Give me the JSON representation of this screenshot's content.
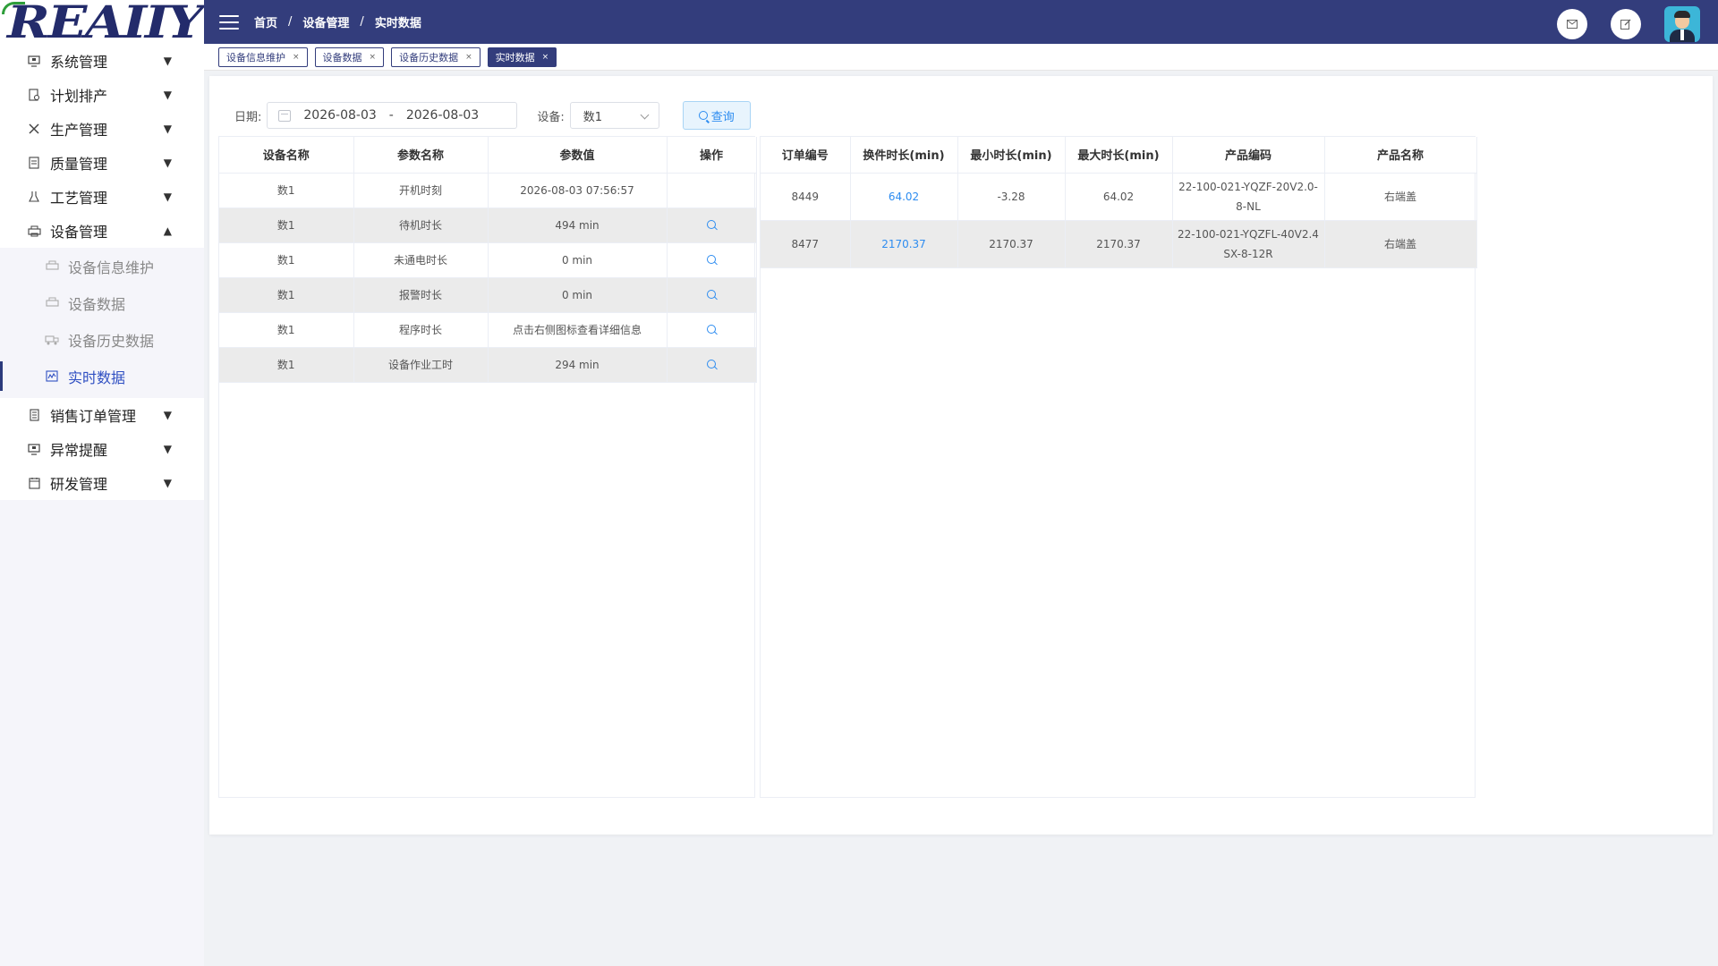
{
  "logo": {
    "text": "REAIIY"
  },
  "header": {
    "breadcrumb": [
      "首页",
      "设备管理",
      "实时数据"
    ],
    "separator": "/"
  },
  "sidebar": {
    "items": [
      {
        "label": "系统管理",
        "icon": "monitor-icon"
      },
      {
        "label": "计划排产",
        "icon": "document-gear-icon"
      },
      {
        "label": "生产管理",
        "icon": "tools-icon"
      },
      {
        "label": "质量管理",
        "icon": "clipboard-icon"
      },
      {
        "label": "工艺管理",
        "icon": "flask-icon"
      },
      {
        "label": "设备管理",
        "icon": "printer-icon",
        "expanded": true
      }
    ],
    "sub_items": [
      {
        "label": "设备信息维护",
        "icon": "printer-icon"
      },
      {
        "label": "设备数据",
        "icon": "printer-icon"
      },
      {
        "label": "设备历史数据",
        "icon": "truck-icon"
      },
      {
        "label": "实时数据",
        "icon": "chart-line-icon",
        "active": true
      }
    ],
    "bottom_items": [
      {
        "label": "销售订单管理",
        "icon": "receipt-icon"
      },
      {
        "label": "异常提醒",
        "icon": "monitor-alert-icon"
      },
      {
        "label": "研发管理",
        "icon": "calendar-icon"
      }
    ]
  },
  "tabs": [
    {
      "label": "设备信息维护",
      "close": "×"
    },
    {
      "label": "设备数据",
      "close": "×"
    },
    {
      "label": "设备历史数据",
      "close": "×"
    },
    {
      "label": "实时数据",
      "close": "×",
      "active": true
    }
  ],
  "filters": {
    "date_label": "日期:",
    "date_start": "2026-08-03",
    "date_sep": "-",
    "date_end": "2026-08-03",
    "device_label": "设备:",
    "device_value": "数1",
    "query_label": "查询"
  },
  "left_table": {
    "columns": [
      "设备名称",
      "参数名称",
      "参数值",
      "操作"
    ],
    "rows": [
      {
        "device": "数1",
        "param": "开机时刻",
        "value": "2026-08-03 07:56:57",
        "action": false
      },
      {
        "device": "数1",
        "param": "待机时长",
        "value": "494 min",
        "action": true
      },
      {
        "device": "数1",
        "param": "未通电时长",
        "value": "0 min",
        "action": true
      },
      {
        "device": "数1",
        "param": "报警时长",
        "value": "0 min",
        "action": true
      },
      {
        "device": "数1",
        "param": "程序时长",
        "value": "点击右侧图标查看详细信息",
        "action": true
      },
      {
        "device": "数1",
        "param": "设备作业工时",
        "value": "294 min",
        "action": true
      }
    ]
  },
  "right_table": {
    "columns": [
      "订单编号",
      "换件时长(min)",
      "最小时长(min)",
      "最大时长(min)",
      "产品编码",
      "产品名称"
    ],
    "rows": [
      {
        "order": "8449",
        "change": "64.02",
        "min": "-3.28",
        "max": "64.02",
        "code_line1": "22-100-021-YQZF-20V2.0-",
        "code_line2": "8-NL",
        "name": "右端盖"
      },
      {
        "order": "8477",
        "change": "2170.37",
        "min": "2170.37",
        "max": "2170.37",
        "code_line1": "22-100-021-YQZFL-40V2.4",
        "code_line2": "SX-8-12R",
        "name": "右端盖"
      }
    ]
  },
  "colors": {
    "header_bg": "#333d7c",
    "accent_blue": "#2d8cf0",
    "active_menu": "#2f4fc2"
  }
}
